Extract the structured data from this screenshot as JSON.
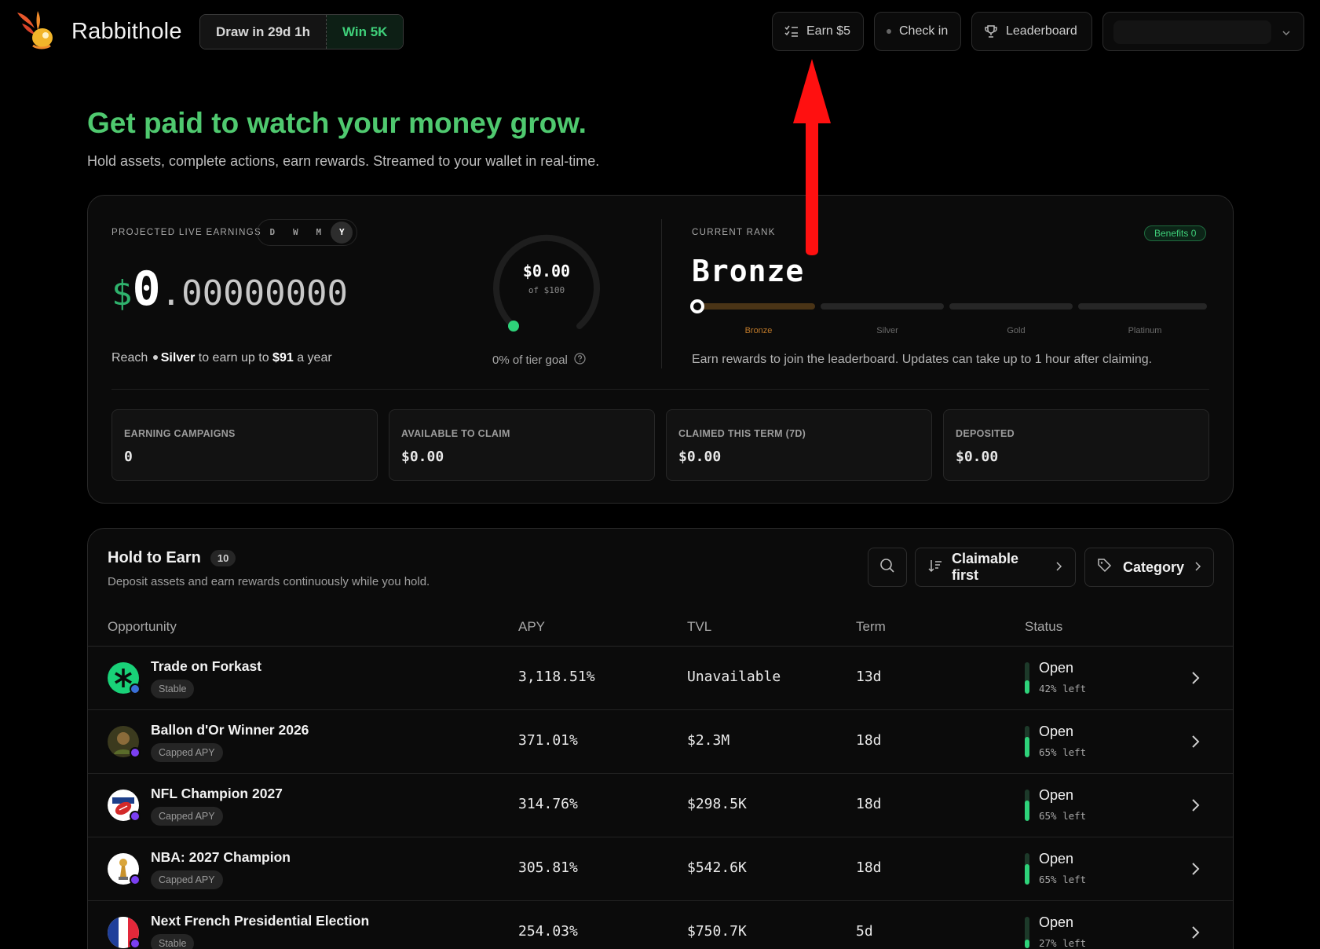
{
  "header": {
    "brand": "Rabbithole",
    "draw": "Draw in 29d 1h",
    "win": "Win 5K",
    "earn_label": "Earn $5",
    "checkin_label": "Check in",
    "leaderboard_label": "Leaderboard"
  },
  "hero": {
    "title": "Get paid to watch your money grow.",
    "subtitle": "Hold assets, complete actions, earn rewards. Streamed to your wallet in real-time."
  },
  "earnings": {
    "label": "Projected live earnings",
    "periods": [
      "D",
      "W",
      "M",
      "Y"
    ],
    "active_period": "Y",
    "currency": "$",
    "amount_int": "0",
    "amount_dec": ".00000000",
    "reach_prefix": "Reach",
    "reach_tier": "Silver",
    "reach_mid": "to earn up to",
    "reach_amount": "$91",
    "reach_suffix": "a year",
    "gauge_value": "$0.00",
    "gauge_of": "of $100",
    "gauge_progress": 0,
    "tier_goal": "0% of tier goal"
  },
  "rank": {
    "label": "Current rank",
    "benefits": "Benefits  0",
    "current": "Bronze",
    "tiers": [
      "Bronze",
      "Silver",
      "Gold",
      "Platinum"
    ],
    "note": "Earn rewards to join the leaderboard. Updates can take up to 1 hour after claiming."
  },
  "stats": [
    {
      "label": "Earning campaigns",
      "value": "0"
    },
    {
      "label": "Available to claim",
      "value": "$0.00"
    },
    {
      "label": "Claimed this term (7D)",
      "value": "$0.00"
    },
    {
      "label": "Deposited",
      "value": "$0.00"
    }
  ],
  "hold": {
    "title": "Hold to Earn",
    "count": "10",
    "subtitle": "Deposit assets and earn rewards continuously while you hold.",
    "sort_label": "Claimable first",
    "category_label": "Category",
    "columns": [
      "Opportunity",
      "APY",
      "TVL",
      "Term",
      "Status"
    ],
    "rows": [
      {
        "name": "Trade on Forkast",
        "tag": "Stable",
        "apy": "3,118.51%",
        "tvl": "Unavailable",
        "term": "13d",
        "status": "Open",
        "left": "42% left",
        "left_pct": 42
      },
      {
        "name": "Ballon d'Or Winner 2026",
        "tag": "Capped APY",
        "apy": "371.01%",
        "tvl": "$2.3M",
        "term": "18d",
        "status": "Open",
        "left": "65% left",
        "left_pct": 65
      },
      {
        "name": "NFL Champion 2027",
        "tag": "Capped APY",
        "apy": "314.76%",
        "tvl": "$298.5K",
        "term": "18d",
        "status": "Open",
        "left": "65% left",
        "left_pct": 65
      },
      {
        "name": "NBA: 2027 Champion",
        "tag": "Capped APY",
        "apy": "305.81%",
        "tvl": "$542.6K",
        "term": "18d",
        "status": "Open",
        "left": "65% left",
        "left_pct": 65
      },
      {
        "name": "Next French Presidential Election",
        "tag": "Stable",
        "apy": "254.03%",
        "tvl": "$750.7K",
        "term": "5d",
        "status": "Open",
        "left": "27% left",
        "left_pct": 27
      }
    ]
  }
}
